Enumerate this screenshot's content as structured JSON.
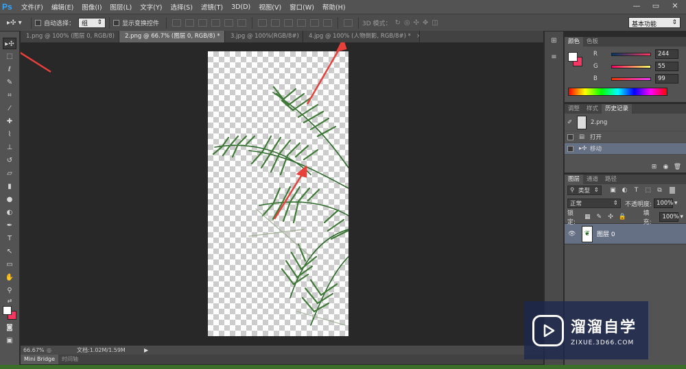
{
  "app": {
    "logo": "Ps"
  },
  "menu": [
    "文件(F)",
    "编辑(E)",
    "图像(I)",
    "图层(L)",
    "文字(Y)",
    "选择(S)",
    "滤镜(T)",
    "3D(D)",
    "视图(V)",
    "窗口(W)",
    "帮助(H)"
  ],
  "window_controls": {
    "minimize": "—",
    "restore": "▭",
    "close": "✕"
  },
  "options": {
    "auto_select_label": "自动选择：",
    "auto_select_value": "组",
    "show_transform_label": "显示变换控件",
    "mode3d_label": "3D 模式：",
    "workspace": "基本功能"
  },
  "tabs": [
    {
      "label": "1.png @ 100% (图层 0, RGB/8)",
      "close": "×"
    },
    {
      "label": "2.png @ 66.7% (图层 0, RGB/8) *",
      "close": "×"
    },
    {
      "label": "3.jpg @ 100%(RGB/8#)",
      "close": "×"
    },
    {
      "label": "4.jpg @ 100% (人物倒影, RGB/8#) *",
      "close": "×"
    }
  ],
  "status": {
    "zoom": "66.67%",
    "doc": "文档:1.02M/1.59M"
  },
  "bottom_tabs": [
    "Mini Bridge",
    "时间轴"
  ],
  "color_panel": {
    "tabs": [
      "颜色",
      "色板"
    ],
    "channels": [
      {
        "name": "R",
        "value": "244"
      },
      {
        "name": "G",
        "value": "55"
      },
      {
        "name": "B",
        "value": "99"
      }
    ],
    "fg_color": "#f43763"
  },
  "history_panel": {
    "tabs": [
      "调整",
      "样式",
      "历史记录"
    ],
    "snapshot": "2.png",
    "items": [
      "打开",
      "移动"
    ]
  },
  "layers_panel": {
    "tabs": [
      "图层",
      "通道",
      "路径"
    ],
    "filter_kind": "类型",
    "blend_mode": "正常",
    "opacity_label": "不透明度:",
    "opacity_value": "100%",
    "lock_label": "锁定:",
    "fill_label": "填充:",
    "fill_value": "100%",
    "layer_name": "图层 0"
  },
  "watermark": {
    "main": "溜溜自学",
    "sub": "ZIXUE.3D66.COM"
  },
  "colors": {
    "accent_arrow": "#e8403b",
    "ps_blue": "#31a8ff",
    "selected_row": "#667085"
  }
}
